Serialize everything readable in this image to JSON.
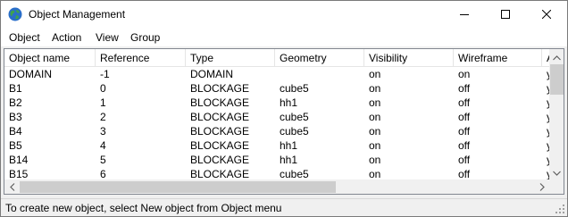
{
  "window": {
    "title": "Object Management"
  },
  "menu": [
    "Object",
    "Action",
    "View",
    "Group"
  ],
  "table": {
    "columns": [
      "Object name",
      "Reference",
      "Type",
      "Geometry",
      "Visibility",
      "Wireframe",
      "A"
    ],
    "rows": [
      [
        "DOMAIN",
        "-1",
        "DOMAIN",
        "",
        "on",
        "on",
        "y"
      ],
      [
        "B1",
        "0",
        "BLOCKAGE",
        "cube5",
        "on",
        "off",
        "y"
      ],
      [
        "B2",
        "1",
        "BLOCKAGE",
        "hh1",
        "on",
        "off",
        "y"
      ],
      [
        "B3",
        "2",
        "BLOCKAGE",
        "cube5",
        "on",
        "off",
        "y"
      ],
      [
        "B4",
        "3",
        "BLOCKAGE",
        "cube5",
        "on",
        "off",
        "y"
      ],
      [
        "B5",
        "4",
        "BLOCKAGE",
        "hh1",
        "on",
        "off",
        "y"
      ],
      [
        "B14",
        "5",
        "BLOCKAGE",
        "hh1",
        "on",
        "off",
        "y"
      ],
      [
        "B15",
        "6",
        "BLOCKAGE",
        "cube5",
        "on",
        "off",
        "y"
      ]
    ]
  },
  "status": {
    "text": "To create new object, select New object from Object menu"
  },
  "icons": {
    "app": "globe-icon",
    "minimize": "minimize-icon",
    "maximize": "maximize-icon",
    "close": "close-icon"
  }
}
